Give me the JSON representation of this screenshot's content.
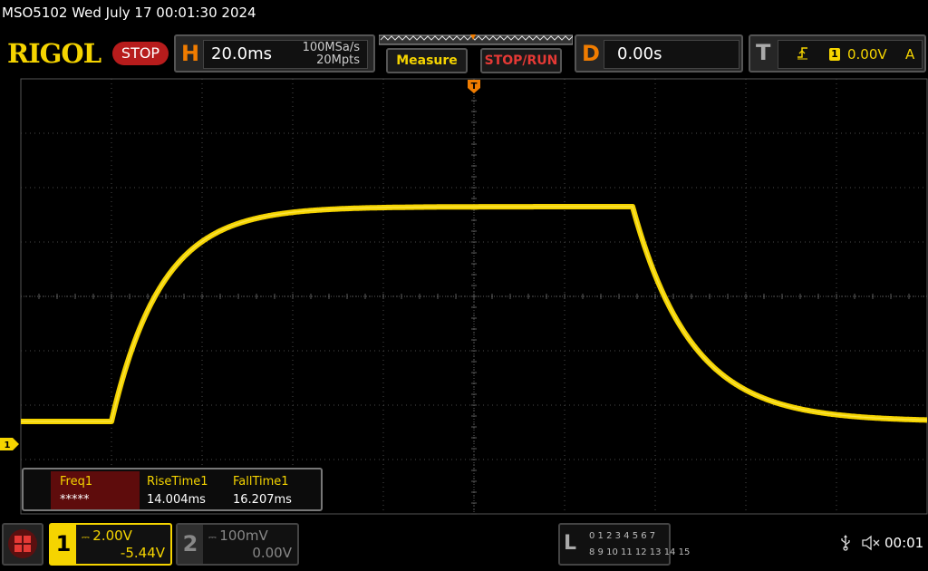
{
  "header": {
    "title": "MSO5102  Wed July 17 00:01:30 2024",
    "logo": "RIGOL",
    "status": "STOP"
  },
  "horizontal": {
    "letter": "H",
    "timebase": "20.0ms",
    "sample_rate": "100MSa/s",
    "memory_depth": "20Mpts"
  },
  "buttons": {
    "measure": "Measure",
    "stop_run": "STOP/RUN"
  },
  "delay": {
    "letter": "D",
    "value": "0.00s"
  },
  "trigger": {
    "letter": "T",
    "edge_icon": "rising-edge-icon",
    "channel": "1",
    "level": "0.00V",
    "mode": "A",
    "marker_label": "T"
  },
  "measurements": [
    {
      "label": "Freq1",
      "value": "*****"
    },
    {
      "label": "RiseTime1",
      "value": "14.004ms"
    },
    {
      "label": "FallTime1",
      "value": "16.207ms"
    }
  ],
  "channels": [
    {
      "num": "1",
      "scale": "2.00V",
      "offset": "-5.44V",
      "color": "#f5d400",
      "active": true
    },
    {
      "num": "2",
      "scale": "100mV",
      "offset": "0.00V",
      "color": "#888888",
      "active": false
    }
  ],
  "logic": {
    "letter": "L",
    "row1": "0 1 2 3   4 5 6 7",
    "row2": "8  9 10 11  12 13 14 15"
  },
  "status_bar": {
    "usb_icon": "usb-icon",
    "speaker_icon": "speaker-muted-icon",
    "time": "00:01"
  },
  "ch1_ground_marker": "1",
  "trace_color": "#f5d400",
  "waveform": {
    "low_level_div": -2.3,
    "high_level_div": 1.65,
    "rise_start_div": -4.0,
    "rise_tau_div": 0.55,
    "fall_start_div": 1.75,
    "fall_tau_div": 0.65,
    "x_range_div": [
      -5,
      5
    ],
    "y_range_div": [
      -4,
      4
    ]
  }
}
